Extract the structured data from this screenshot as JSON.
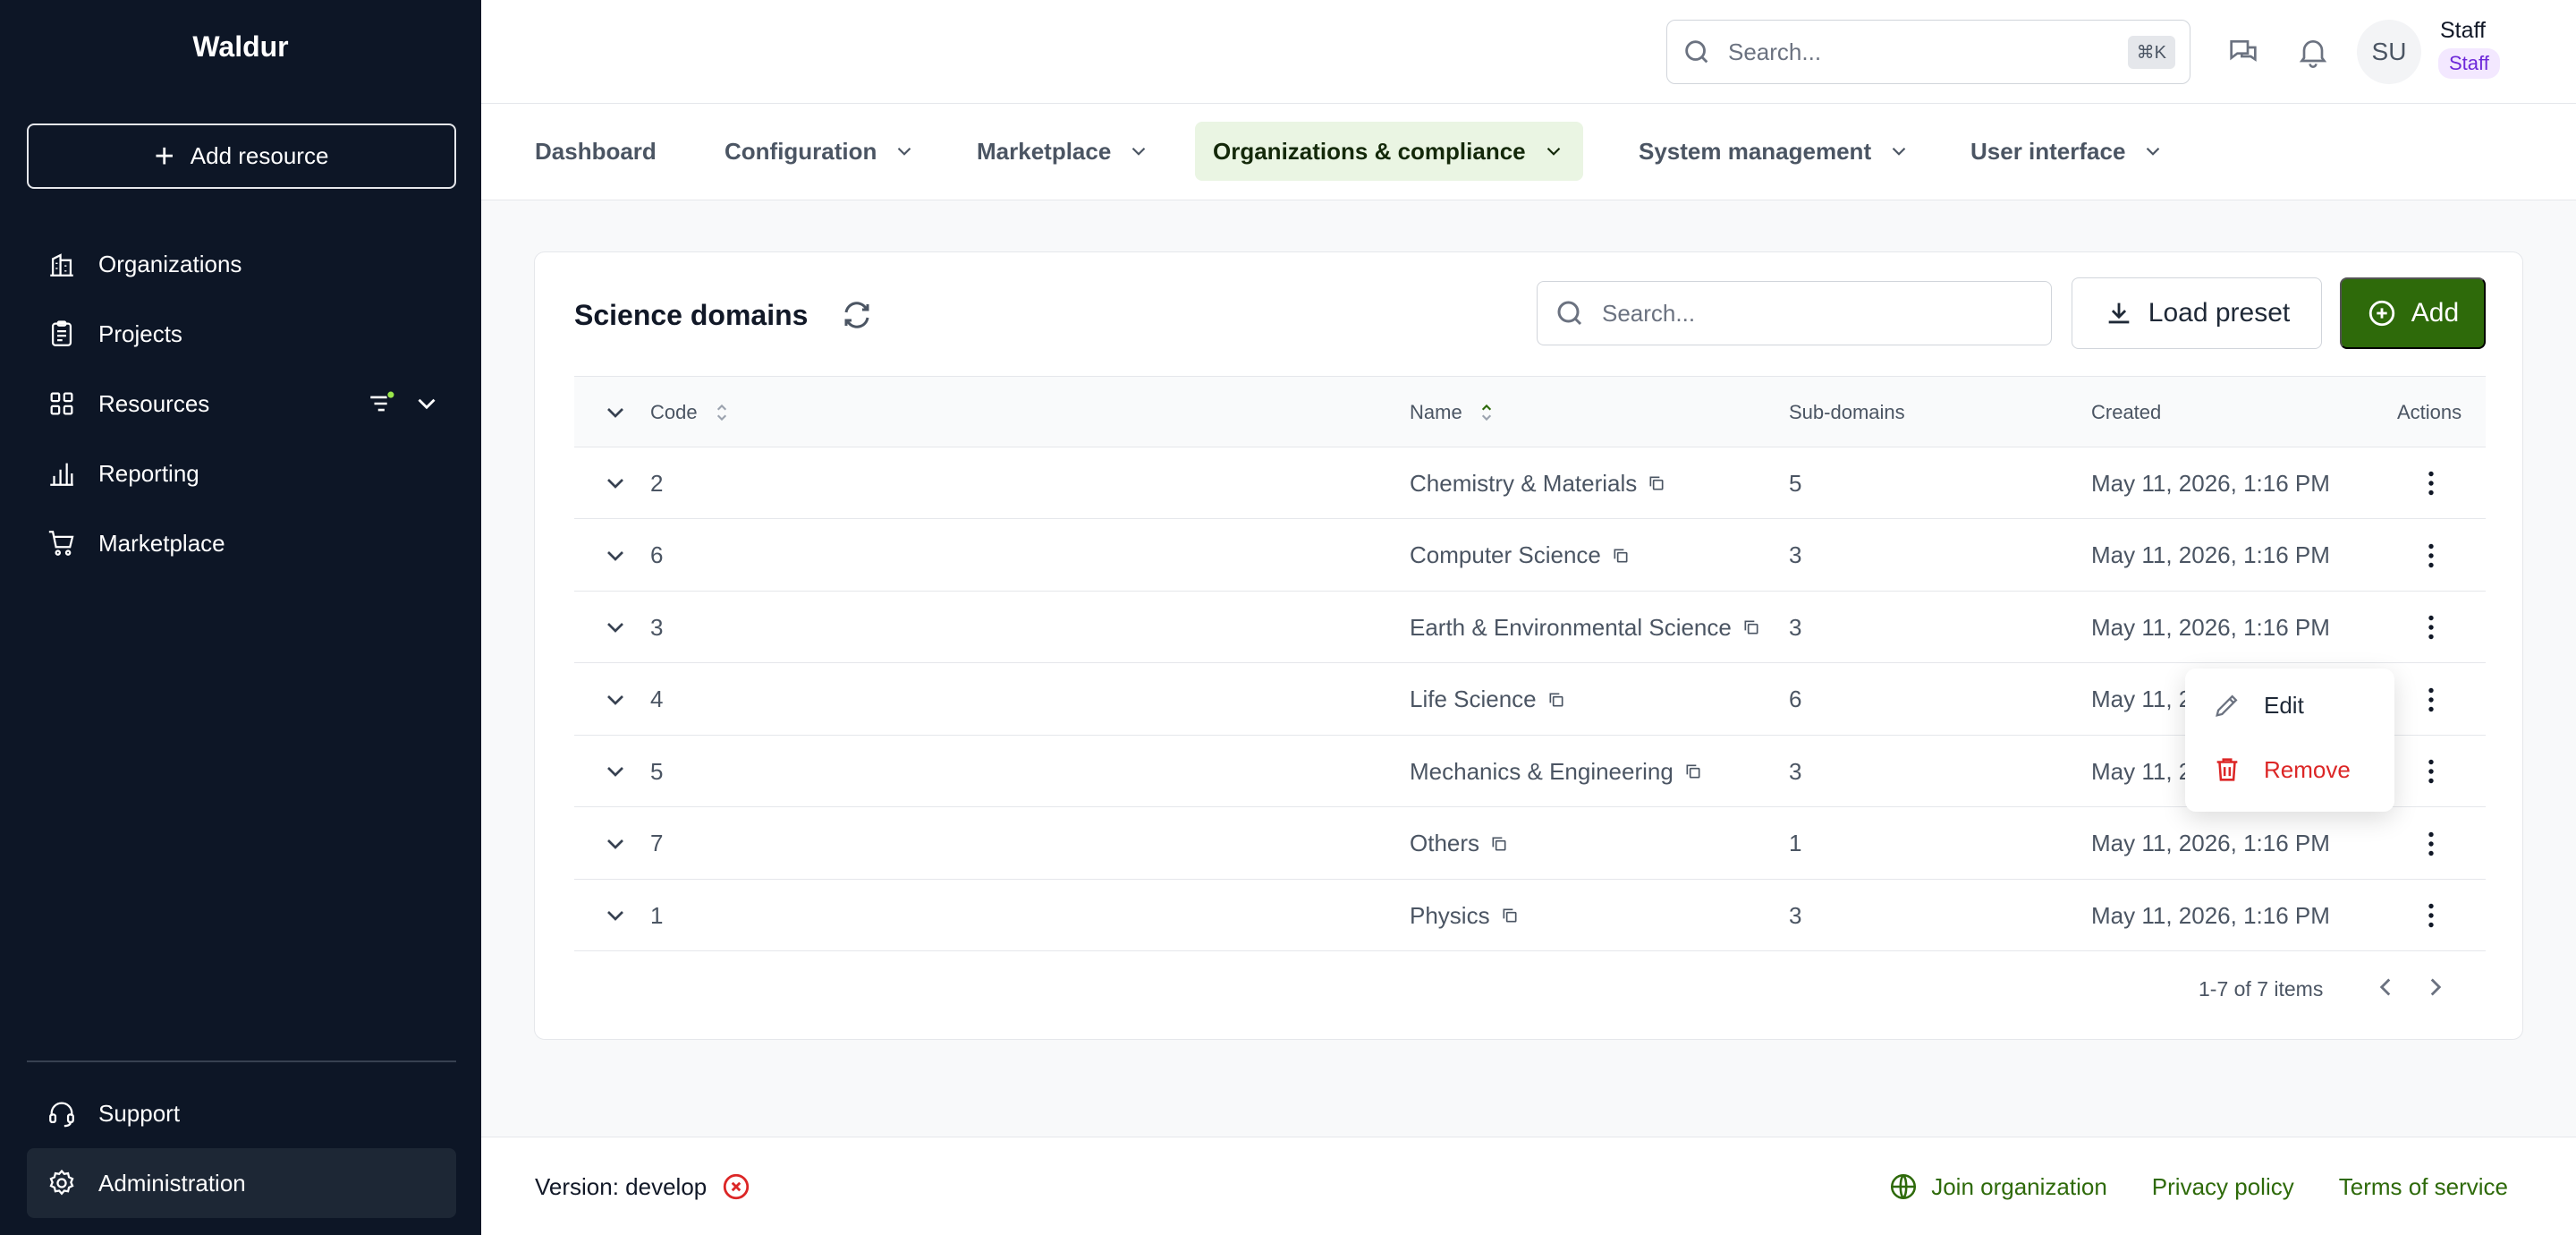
{
  "brand": "Waldur",
  "sidebar": {
    "add_resource": "Add resource",
    "items": [
      {
        "label": "Organizations",
        "icon": "building-icon"
      },
      {
        "label": "Projects",
        "icon": "clipboard-icon"
      },
      {
        "label": "Resources",
        "icon": "grid-icon"
      },
      {
        "label": "Reporting",
        "icon": "bar-chart-icon"
      },
      {
        "label": "Marketplace",
        "icon": "cart-icon"
      }
    ],
    "bottom_items": [
      {
        "label": "Support",
        "icon": "headset-icon"
      },
      {
        "label": "Administration",
        "icon": "gear-icon"
      }
    ]
  },
  "header": {
    "search_placeholder": "Search...",
    "search_shortcut": "⌘K",
    "avatar_initials": "SU",
    "user_name": "Staff",
    "user_role": "Staff"
  },
  "tabs": [
    {
      "label": "Dashboard"
    },
    {
      "label": "Configuration"
    },
    {
      "label": "Marketplace"
    },
    {
      "label": "Organizations & compliance"
    },
    {
      "label": "System management"
    },
    {
      "label": "User interface"
    }
  ],
  "table": {
    "title": "Science domains",
    "search_placeholder": "Search...",
    "load_preset": "Load preset",
    "add": "Add",
    "columns": {
      "code": "Code",
      "name": "Name",
      "subdomains": "Sub-domains",
      "created": "Created",
      "actions": "Actions"
    },
    "rows": [
      {
        "code": "2",
        "name": "Chemistry & Materials",
        "subdomains": "5",
        "created": "May 11, 2026, 1:16 PM"
      },
      {
        "code": "6",
        "name": "Computer Science",
        "subdomains": "3",
        "created": "May 11, 2026, 1:16 PM"
      },
      {
        "code": "3",
        "name": "Earth & Environmental Science",
        "subdomains": "3",
        "created": "May 11, 2026, 1:16 PM"
      },
      {
        "code": "4",
        "name": "Life Science",
        "subdomains": "6",
        "created": "May 11, 2026, 1:16 PM"
      },
      {
        "code": "5",
        "name": "Mechanics & Engineering",
        "subdomains": "3",
        "created": "May 11, 2026, 1:16 PM"
      },
      {
        "code": "7",
        "name": "Others",
        "subdomains": "1",
        "created": "May 11, 2026, 1:16 PM"
      },
      {
        "code": "1",
        "name": "Physics",
        "subdomains": "3",
        "created": "May 11, 2026, 1:16 PM"
      }
    ],
    "pager": "1-7 of 7 items"
  },
  "menu": {
    "edit": "Edit",
    "remove": "Remove"
  },
  "footer": {
    "version": "Version: develop",
    "join": "Join organization",
    "privacy": "Privacy policy",
    "terms": "Terms of service"
  },
  "colors": {
    "sidebar_bg": "#0d1626",
    "accent": "#2e6a0a",
    "active_tab_bg": "#eaf5e3",
    "danger": "#dc2626"
  }
}
